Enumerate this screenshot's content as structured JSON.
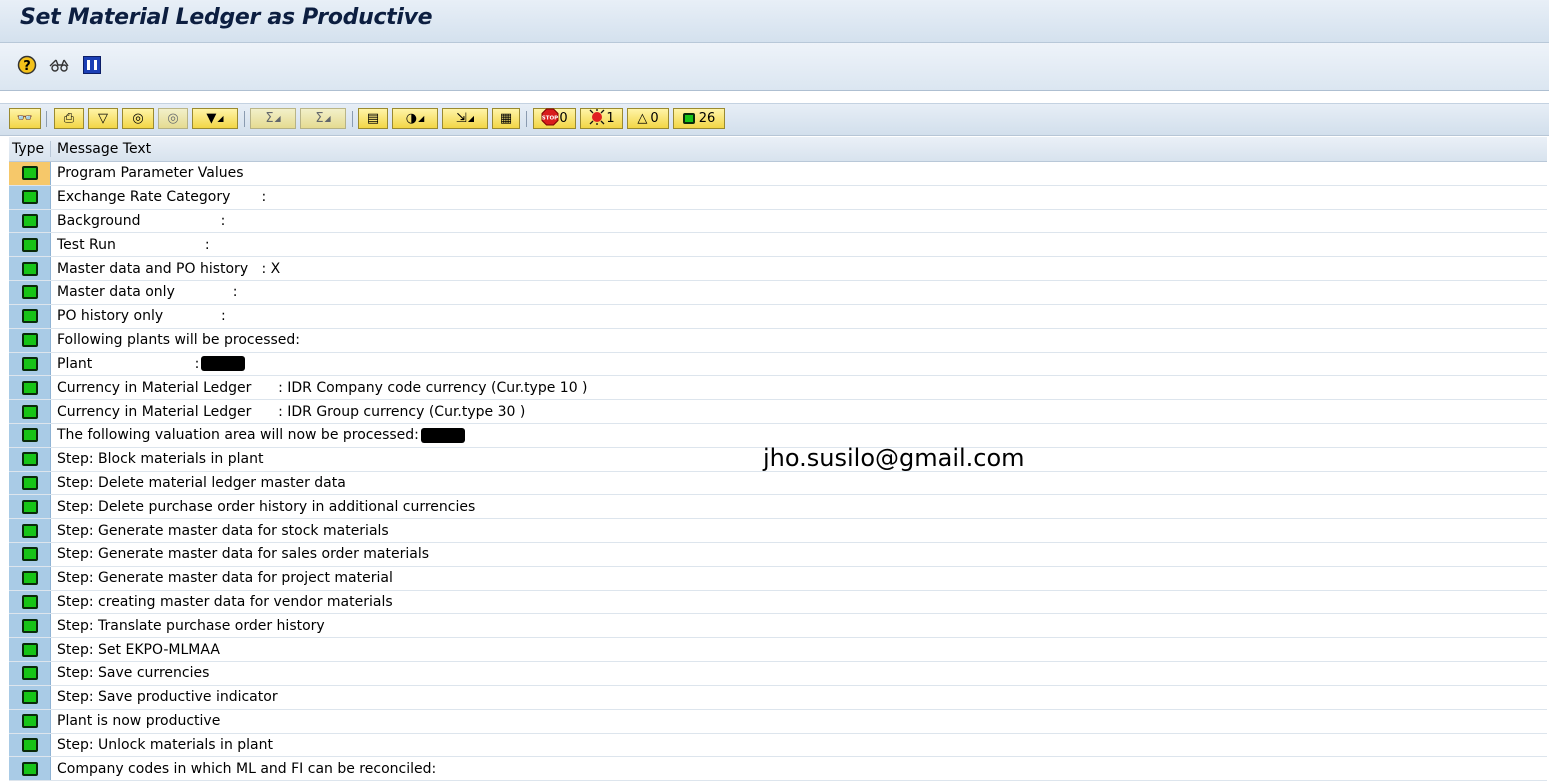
{
  "window": {
    "title": "Set Material Ledger as Productive"
  },
  "app_toolbar": {
    "icons": [
      "help-icon",
      "glasses-icon",
      "info-icon"
    ]
  },
  "alv_toolbar": {
    "buttons": [
      "details",
      "print",
      "filter",
      "find",
      "find-next",
      "set-filter",
      "total",
      "subtotal",
      "print-preview",
      "export",
      "save-layout",
      "grid"
    ],
    "counters": {
      "error": "0",
      "warning_red": "1",
      "warning": "0",
      "success": "26"
    }
  },
  "table": {
    "columns": [
      "Type",
      "Message Text"
    ],
    "rows": [
      {
        "type": "success",
        "text": "Program Parameter Values"
      },
      {
        "type": "success",
        "text": "Exchange Rate Category       :"
      },
      {
        "type": "success",
        "text": "Background                  :"
      },
      {
        "type": "success",
        "text": "Test Run                    :"
      },
      {
        "type": "success",
        "text": "Master data and PO history   : X"
      },
      {
        "type": "success",
        "text": "Master data only             :"
      },
      {
        "type": "success",
        "text": "PO history only             :"
      },
      {
        "type": "success",
        "text": "Following plants will be processed:"
      },
      {
        "type": "success",
        "text": "Plant                       :",
        "redacted": true
      },
      {
        "type": "success",
        "text": "Currency in Material Ledger      : IDR Company code currency (Cur.type 10 )"
      },
      {
        "type": "success",
        "text": "Currency in Material Ledger      : IDR Group currency (Cur.type 30 )"
      },
      {
        "type": "success",
        "text": "The following valuation area will now be processed:",
        "redacted": true
      },
      {
        "type": "success",
        "text": "Step: Block materials in plant"
      },
      {
        "type": "success",
        "text": "Step: Delete material ledger master data"
      },
      {
        "type": "success",
        "text": "Step: Delete purchase order history in additional currencies"
      },
      {
        "type": "success",
        "text": "Step: Generate master data for stock materials"
      },
      {
        "type": "success",
        "text": "Step: Generate master data for sales order materials"
      },
      {
        "type": "success",
        "text": "Step: Generate master data for project material"
      },
      {
        "type": "success",
        "text": "Step: creating master data for vendor materials"
      },
      {
        "type": "success",
        "text": "Step: Translate purchase order history"
      },
      {
        "type": "success",
        "text": "Step: Set EKPO-MLMAA"
      },
      {
        "type": "success",
        "text": "Step: Save currencies"
      },
      {
        "type": "success",
        "text": "Step: Save productive indicator"
      },
      {
        "type": "success",
        "text": "Plant is now productive"
      },
      {
        "type": "success",
        "text": "Step: Unlock materials in plant"
      },
      {
        "type": "success",
        "text": "Company codes in which ML and FI can be reconciled:"
      }
    ]
  },
  "watermark": "jho.susilo@gmail.com"
}
